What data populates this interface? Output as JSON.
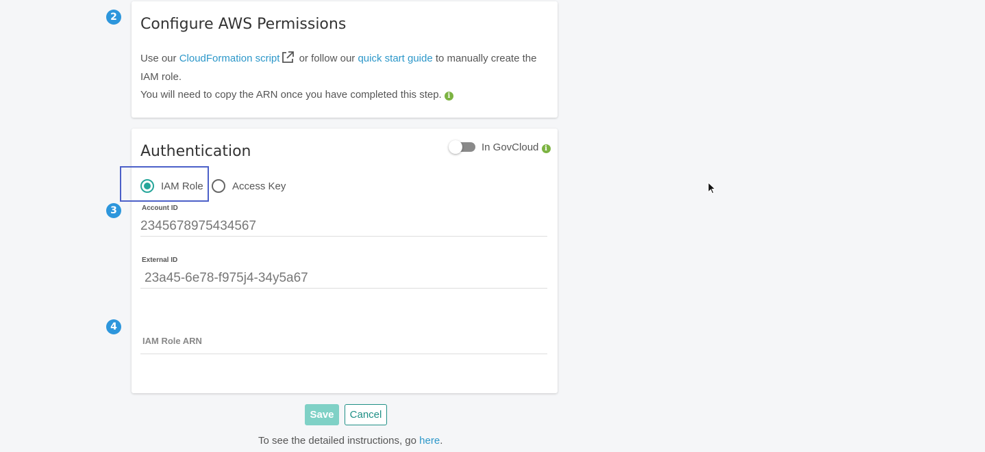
{
  "steps": {
    "configure": "2",
    "account": "3",
    "arn": "4"
  },
  "configure_card": {
    "title": "Configure AWS Permissions",
    "text_prefix": "Use our ",
    "cloudformation_link": "CloudFormation script",
    "text_middle": " or follow our ",
    "quick_start_link": "quick start guide",
    "text_suffix": " to manually create the IAM role.",
    "copy_note": "You will need to copy the ARN once you have completed this step."
  },
  "auth_card": {
    "title": "Authentication",
    "govcloud_label": "In GovCloud",
    "govcloud_enabled": false,
    "auth_options": [
      {
        "label": "IAM Role",
        "selected": true
      },
      {
        "label": "Access Key",
        "selected": false
      }
    ],
    "account_id_label": "Account ID",
    "account_id_value": "2345678975434567",
    "external_id_label": "External ID",
    "external_id_value": "23a45-6e78-f975j4-34y5a67",
    "iam_role_arn_label": "IAM Role ARN",
    "iam_role_arn_value": ""
  },
  "actions": {
    "save_label": "Save",
    "cancel_label": "Cancel"
  },
  "footer": {
    "text_prefix": "To see the detailed instructions, go ",
    "link_label": "here",
    "text_suffix": "."
  },
  "icons": {
    "step_badge_color": "#2d96dc",
    "info_color": "#7cb342",
    "accent": "#26a69a",
    "link_color": "#2c97c9",
    "info_icon": "info-icon",
    "external_link_icon": "external-link-icon"
  }
}
